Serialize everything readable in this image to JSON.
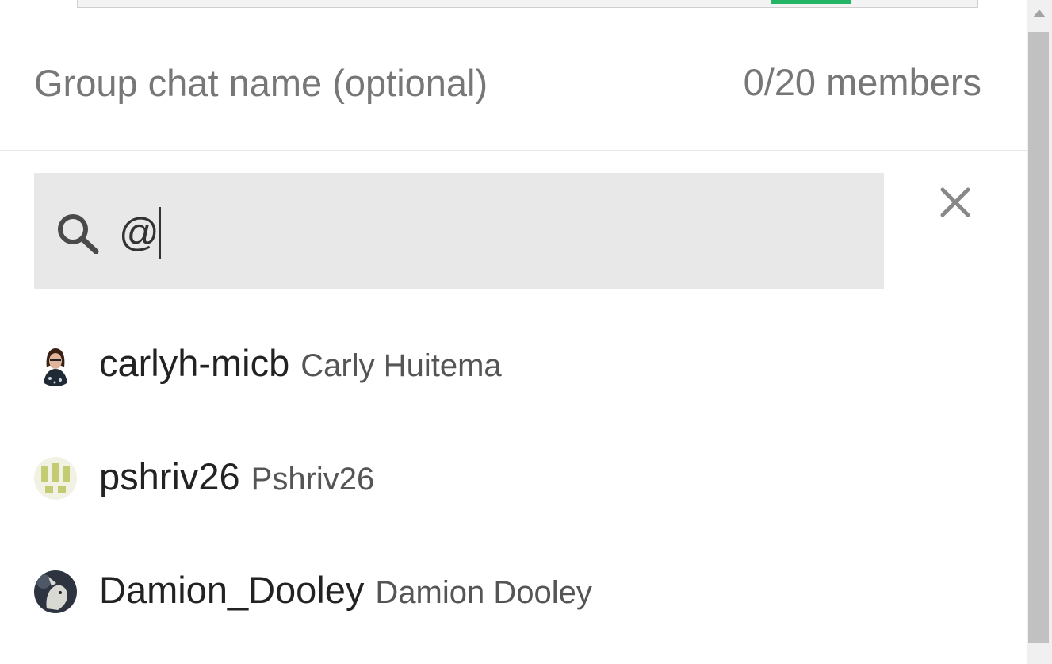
{
  "group": {
    "name_placeholder": "Group chat name (optional)",
    "member_count": "0/20 members"
  },
  "search": {
    "query": "@"
  },
  "results": [
    {
      "username": "carlyh-micb",
      "full_name": "Carly Huitema"
    },
    {
      "username": "pshriv26",
      "full_name": "Pshriv26"
    },
    {
      "username": "Damion_Dooley",
      "full_name": "Damion Dooley"
    }
  ],
  "colors": {
    "search_bg": "#e8e8e8",
    "accent_green": "#23b466"
  }
}
